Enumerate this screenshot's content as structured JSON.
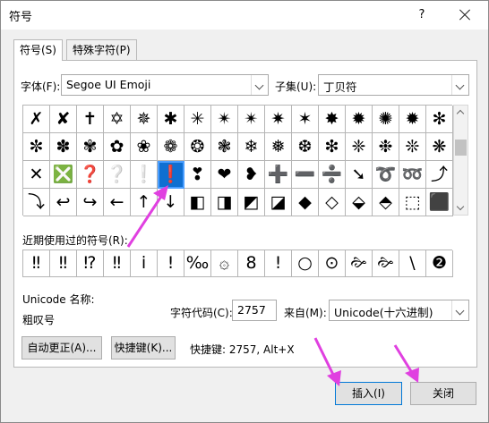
{
  "window": {
    "title": "符号",
    "help": "?"
  },
  "tabs": [
    {
      "label": "符号(S)"
    },
    {
      "label": "特殊字符(P)"
    }
  ],
  "font": {
    "label": "字体(F):",
    "value": "Segoe UI Emoji"
  },
  "subset": {
    "label": "子集(U):",
    "value": "丁贝符"
  },
  "symbols": [
    "✗",
    "✘",
    "✝",
    "✡",
    "✵",
    "✱",
    "✳",
    "✴",
    "✴",
    "✷",
    "✶",
    "✸",
    "✹",
    "✺",
    "✹",
    "✻",
    "✼",
    "✽",
    "✾",
    "✿",
    "❀",
    "❁",
    "❂",
    "❃",
    "❄",
    "❅",
    "❆",
    "❇",
    "❈",
    "❉",
    "❊",
    "❋",
    "✕",
    "❎",
    "❓",
    "❔",
    "❕",
    "❗",
    "❣",
    "❤",
    "❥",
    "➕",
    "➖",
    "➗",
    "➘",
    "➰",
    "➿",
    "⤴",
    "⤵",
    "↩",
    "↪",
    "←",
    "↑",
    "↓",
    "◧",
    "◨",
    "◩",
    "◪",
    "◆",
    "◇",
    "⬙",
    "⬘",
    "⬚",
    "⬛"
  ],
  "selected_index": 37,
  "recent": {
    "label": "近期使用过的符号(R):",
    "symbols": [
      "‼",
      "‼",
      "⁉",
      "‼",
      "ⅰ",
      "!",
      "‰",
      "۞",
      "8",
      "!",
      "○",
      "⊙",
      "🙚",
      "🙚",
      "\\",
      "❷"
    ]
  },
  "unicode_name": {
    "label": "Unicode 名称:",
    "value": "粗叹号"
  },
  "char_code": {
    "label": "字符代码(C):",
    "value": "2757"
  },
  "from": {
    "label": "来自(M):",
    "value": "Unicode(十六进制)"
  },
  "buttons": {
    "autocorrect": "自动更正(A)...",
    "shortcut": "快捷键(K)...",
    "insert": "插入(I)",
    "close": "关闭"
  },
  "shortcut_text": "快捷键: 2757, Alt+X",
  "colors": {
    "annotation_arrow": "#e040e0",
    "selection": "#0f6fd1"
  }
}
